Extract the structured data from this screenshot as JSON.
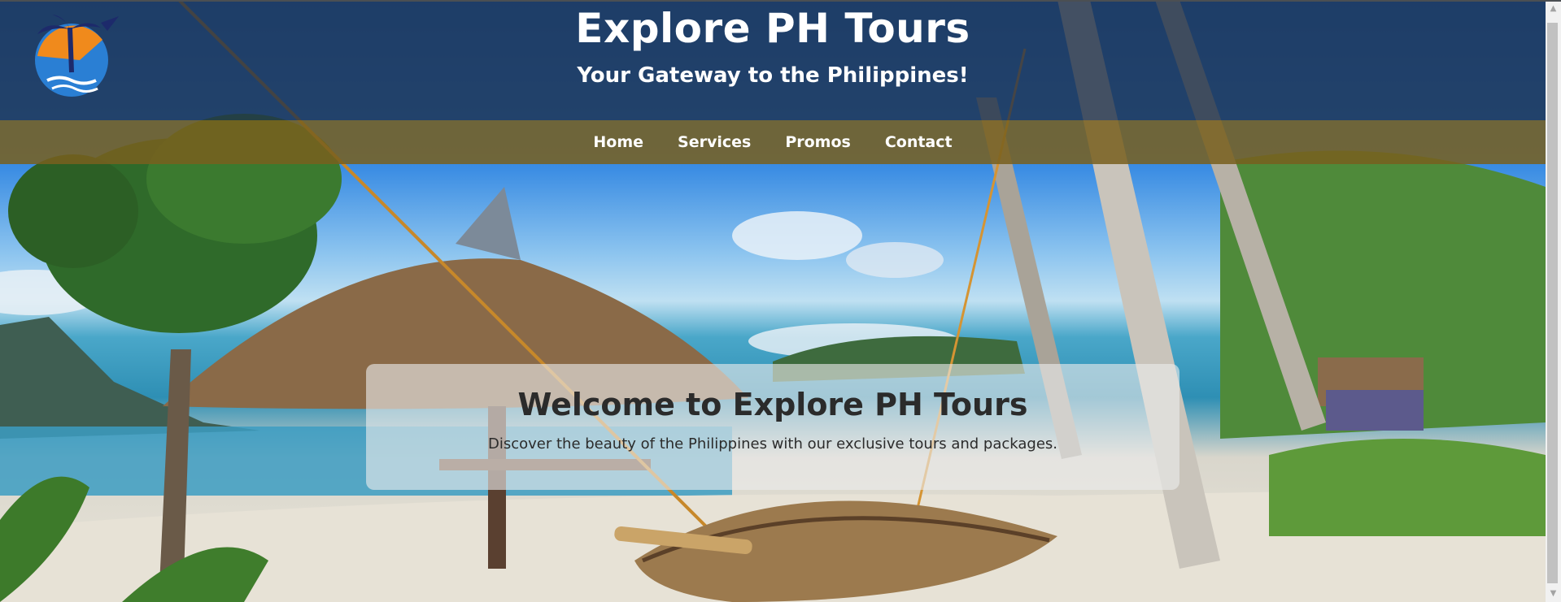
{
  "header": {
    "title": "Explore PH Tours",
    "subtitle": "Your Gateway to the Philippines!"
  },
  "nav": {
    "items": [
      {
        "label": "Home"
      },
      {
        "label": "Services"
      },
      {
        "label": "Promos"
      },
      {
        "label": "Contact"
      }
    ]
  },
  "hero": {
    "title": "Welcome to Explore PH Tours",
    "text": "Discover the beauty of the Philippines with our exclusive tours and packages."
  },
  "logo": {
    "icon": "palm-sun-plane-logo",
    "colors": {
      "sun": "#f08a1c",
      "globe": "#2a7fd4",
      "palm": "#1d2a6b"
    }
  },
  "colors": {
    "header_band": "#1e304a",
    "nav_band": "#785f1e",
    "text_light": "#ffffff",
    "text_dark": "#2b2b2b"
  }
}
